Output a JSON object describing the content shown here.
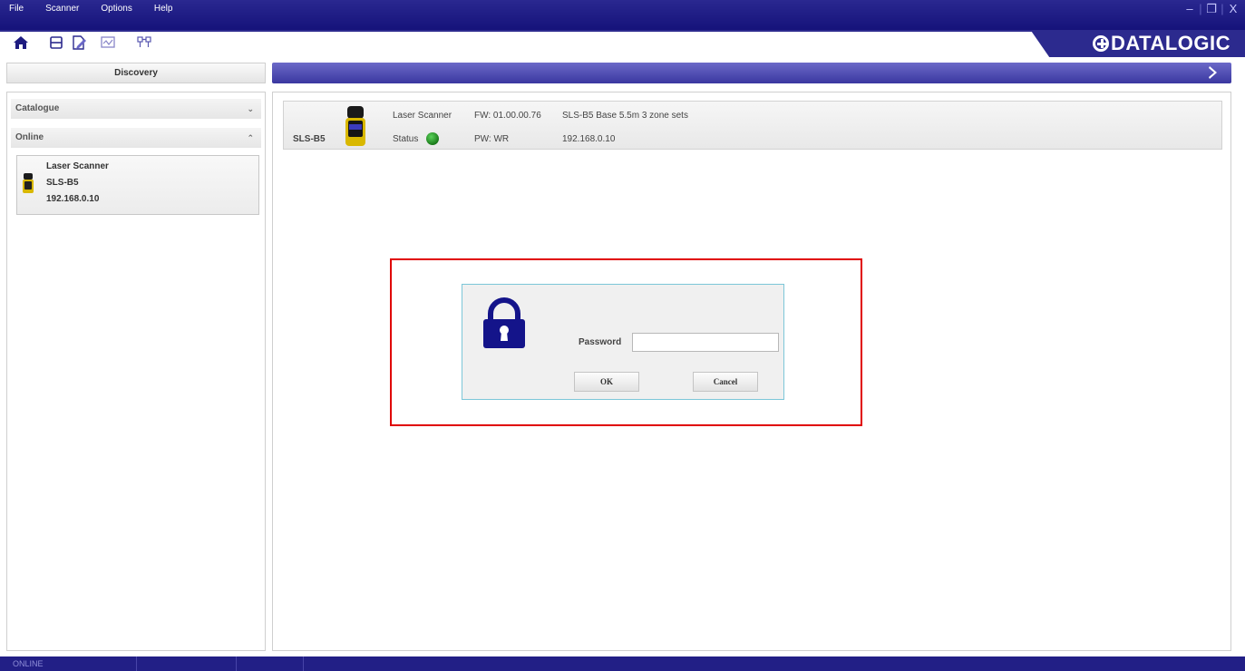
{
  "menu": {
    "items": [
      "File",
      "Scanner",
      "Options",
      "Help"
    ]
  },
  "window_controls": {
    "minimize": "–",
    "restore": "❐",
    "close": "X"
  },
  "toolbar": {
    "icons": [
      "home-icon",
      "save-icon",
      "edit-document-icon",
      "monitor-icon",
      "network-icon"
    ]
  },
  "brand": {
    "logo_text": "DATALOGIC",
    "accent": "#2c2a8e"
  },
  "discovery": {
    "button_label": "Discovery"
  },
  "sidebar": {
    "catalogue_label": "Catalogue",
    "online_label": "Online",
    "device": {
      "type": "Laser Scanner",
      "model": "SLS-B5",
      "ip": "192.168.0.10"
    }
  },
  "device_row": {
    "model": "SLS-B5",
    "type": "Laser Scanner",
    "firmware": "FW: 01.00.00.76",
    "description": "SLS-B5 Base 5.5m 3 zone sets",
    "status_label": "Status",
    "status_color": "#1e8c1e",
    "pw": "PW: WR",
    "ip": "192.168.0.10"
  },
  "password_dialog": {
    "label": "Password",
    "value": "",
    "ok_label": "OK",
    "cancel_label": "Cancel",
    "highlight_color": "#e00000"
  },
  "statusbar": {
    "text": "ONLINE"
  }
}
